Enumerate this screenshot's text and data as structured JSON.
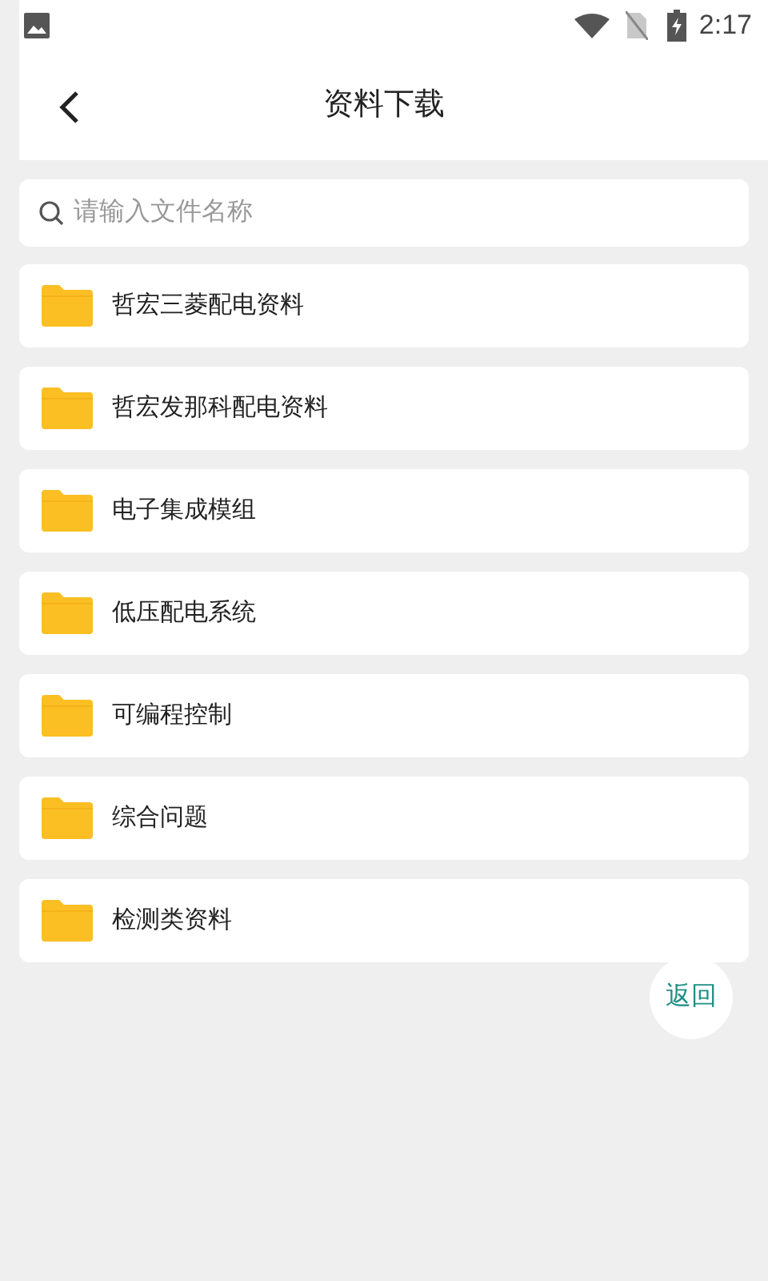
{
  "status_bar": {
    "time": "2:17"
  },
  "header": {
    "title": "资料下载"
  },
  "search": {
    "placeholder": "请输入文件名称"
  },
  "folders": [
    {
      "name": "哲宏三菱配电资料"
    },
    {
      "name": "哲宏发那科配电资料"
    },
    {
      "name": "电子集成模组"
    },
    {
      "name": "低压配电系统"
    },
    {
      "name": "可编程控制"
    },
    {
      "name": "综合问题"
    },
    {
      "name": "检测类资料"
    }
  ],
  "back_button": {
    "label": "返回"
  }
}
